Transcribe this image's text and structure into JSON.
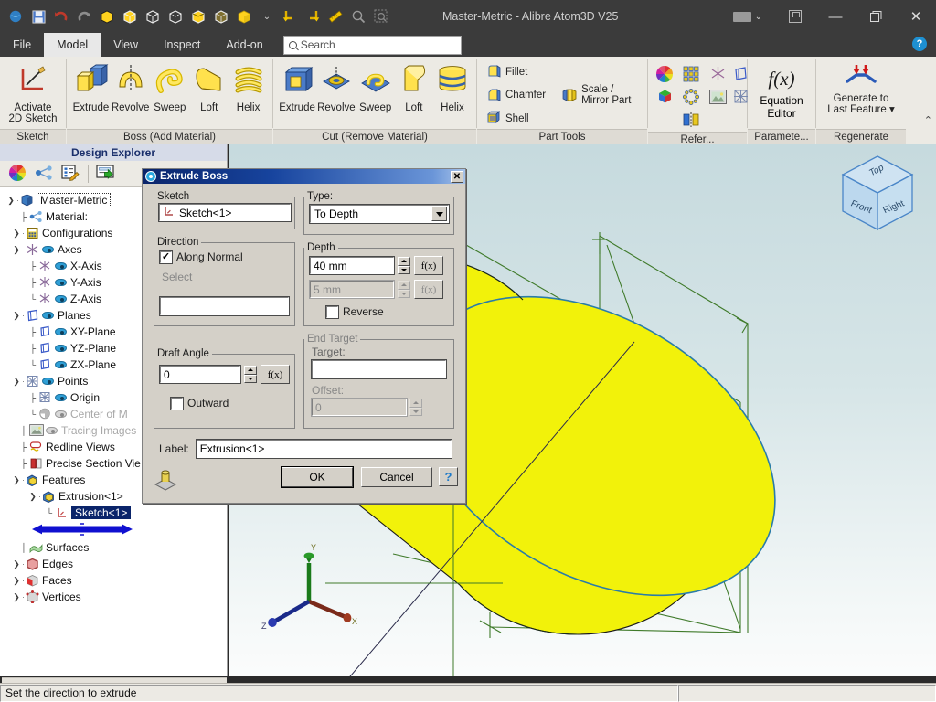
{
  "window": {
    "title": "Master-Metric - Alibre Atom3D V25",
    "minimize_label": "—",
    "maximize_label": "❐",
    "close_label": "✕",
    "ribbon_display_label": "ribbon-display-options",
    "help_label": "?"
  },
  "quick_access": {
    "items": [
      {
        "name": "home-icon",
        "tip": "Home"
      },
      {
        "name": "save-icon",
        "tip": "Save"
      },
      {
        "name": "undo-icon",
        "tip": "Undo"
      },
      {
        "name": "redo-icon",
        "tip": "Redo"
      },
      {
        "name": "display-shaded-icon",
        "tip": "Shaded"
      },
      {
        "name": "display-shaded-edges-icon",
        "tip": "Shaded with Edges"
      },
      {
        "name": "display-wireframe-icon",
        "tip": "Wireframe"
      },
      {
        "name": "display-hidden-line-icon",
        "tip": "Hidden Line"
      },
      {
        "name": "display-hidden-line-removed-icon",
        "tip": "Hidden Line Removed"
      },
      {
        "name": "display-transparent-icon",
        "tip": "Transparent"
      },
      {
        "name": "display-realistic-icon",
        "tip": "Realistic"
      },
      {
        "name": "display-more-chevron-icon",
        "tip": "More"
      },
      {
        "name": "rotate-left-icon",
        "tip": "Rotate Left"
      },
      {
        "name": "rotate-right-icon",
        "tip": "Rotate Right"
      },
      {
        "name": "measure-icon",
        "tip": "Measure"
      },
      {
        "name": "zoom-icon",
        "tip": "Zoom"
      },
      {
        "name": "zoom-window-icon",
        "tip": "Zoom Window"
      }
    ]
  },
  "tabs": {
    "items": [
      {
        "label": "File",
        "active": false
      },
      {
        "label": "Model",
        "active": true
      },
      {
        "label": "View",
        "active": false
      },
      {
        "label": "Inspect",
        "active": false
      },
      {
        "label": "Add-on",
        "active": false
      }
    ]
  },
  "search": {
    "placeholder": "Search",
    "value": ""
  },
  "ribbon": {
    "groups": [
      {
        "label": "Sketch",
        "buttons": [
          {
            "label": "Activate\n2D Sketch",
            "label_line1": "Activate",
            "label_line2": "2D Sketch",
            "icon": "activate-2d-sketch-icon"
          }
        ]
      },
      {
        "label": "Boss (Add Material)",
        "buttons": [
          {
            "label": "Extrude",
            "icon": "boss-extrude-icon"
          },
          {
            "label": "Revolve",
            "icon": "boss-revolve-icon"
          },
          {
            "label": "Sweep",
            "icon": "boss-sweep-icon"
          },
          {
            "label": "Loft",
            "icon": "boss-loft-icon"
          },
          {
            "label": "Helix",
            "icon": "boss-helix-icon"
          }
        ]
      },
      {
        "label": "Cut (Remove Material)",
        "buttons": [
          {
            "label": "Extrude",
            "icon": "cut-extrude-icon"
          },
          {
            "label": "Revolve",
            "icon": "cut-revolve-icon"
          },
          {
            "label": "Sweep",
            "icon": "cut-sweep-icon"
          },
          {
            "label": "Loft",
            "icon": "cut-loft-icon"
          },
          {
            "label": "Helix",
            "icon": "cut-helix-icon"
          }
        ]
      },
      {
        "label": "Part Tools",
        "items": [
          {
            "label": "Fillet",
            "icon": "fillet-icon"
          },
          {
            "label": "Chamfer",
            "icon": "chamfer-icon"
          },
          {
            "label": "Shell",
            "icon": "shell-icon"
          },
          {
            "label": "Scale / Mirror Part",
            "icon": "scale-mirror-part-icon"
          }
        ]
      },
      {
        "label": "Refer...",
        "icons": [
          {
            "name": "color-wheel-icon"
          },
          {
            "name": "material-cube-icon"
          },
          {
            "name": "pattern-grid-icon"
          },
          {
            "name": "circular-pattern-icon"
          },
          {
            "name": "mirror-icon"
          },
          {
            "name": "reference-axis-icon"
          },
          {
            "name": "reference-plane-icon"
          },
          {
            "name": "tracing-image-icon"
          },
          {
            "name": "reference-point-icon"
          }
        ]
      },
      {
        "label": "Paramete...",
        "buttons": [
          {
            "label_line1": "Equation",
            "label_line2": "Editor",
            "icon": "equation-editor-icon",
            "glyph": "f(x)"
          }
        ]
      },
      {
        "label": "Regenerate",
        "buttons": [
          {
            "label_line1": "Generate to",
            "label_line2": "Last Feature ▾",
            "icon": "generate-to-last-feature-icon"
          }
        ]
      }
    ],
    "collapse_label": "⌃"
  },
  "design_explorer": {
    "title": "Design Explorer",
    "toolbar": [
      {
        "name": "color-properties-icon"
      },
      {
        "name": "relationships-icon"
      },
      {
        "name": "edit-properties-icon"
      },
      {
        "name": "export-notes-icon"
      }
    ],
    "tree": [
      {
        "label": "Master-Metric",
        "depth": 0,
        "chevron": "down",
        "icon": "part-icon",
        "eye": "none",
        "style": "dotted"
      },
      {
        "label": "Material:",
        "depth": 1,
        "chevron": "none",
        "icon": "material-icon",
        "eye": "none",
        "style": "normal"
      },
      {
        "label": "Configurations",
        "depth": 1,
        "chevron": "right",
        "icon": "configurations-icon",
        "eye": "none",
        "style": "normal"
      },
      {
        "label": "Axes",
        "depth": 1,
        "chevron": "down",
        "icon": "axis-icon",
        "eye": "on",
        "style": "normal"
      },
      {
        "label": "X-Axis",
        "depth": 2,
        "chevron": "none",
        "icon": "axis-icon",
        "eye": "on",
        "style": "normal"
      },
      {
        "label": "Y-Axis",
        "depth": 2,
        "chevron": "none",
        "icon": "axis-icon",
        "eye": "on",
        "style": "normal"
      },
      {
        "label": "Z-Axis",
        "depth": 2,
        "chevron": "none",
        "icon": "axis-icon",
        "eye": "on",
        "style": "normal"
      },
      {
        "label": "Planes",
        "depth": 1,
        "chevron": "down",
        "icon": "plane-icon",
        "eye": "on",
        "style": "normal"
      },
      {
        "label": "XY-Plane",
        "depth": 2,
        "chevron": "none",
        "icon": "plane-icon",
        "eye": "on",
        "style": "normal"
      },
      {
        "label": "YZ-Plane",
        "depth": 2,
        "chevron": "none",
        "icon": "plane-icon",
        "eye": "on",
        "style": "normal"
      },
      {
        "label": "ZX-Plane",
        "depth": 2,
        "chevron": "none",
        "icon": "plane-icon",
        "eye": "on",
        "style": "normal"
      },
      {
        "label": "Points",
        "depth": 1,
        "chevron": "down",
        "icon": "point-icon",
        "eye": "on",
        "style": "normal"
      },
      {
        "label": "Origin",
        "depth": 2,
        "chevron": "none",
        "icon": "point-icon",
        "eye": "on",
        "style": "normal"
      },
      {
        "label": "Center of M",
        "depth": 2,
        "chevron": "none",
        "icon": "center-of-mass-icon",
        "eye": "off",
        "style": "dim"
      },
      {
        "label": "Tracing Images",
        "depth": 1,
        "chevron": "none",
        "icon": "tracing-images-icon",
        "eye": "off",
        "style": "dim"
      },
      {
        "label": "Redline Views",
        "depth": 1,
        "chevron": "none",
        "icon": "redline-views-icon",
        "eye": "none",
        "style": "normal"
      },
      {
        "label": "Precise Section Vie",
        "depth": 1,
        "chevron": "none",
        "icon": "precise-section-views-icon",
        "eye": "none",
        "style": "normal"
      },
      {
        "label": "Features",
        "depth": 1,
        "chevron": "down",
        "icon": "features-icon",
        "eye": "none",
        "style": "normal"
      },
      {
        "label": "Extrusion<1>",
        "depth": 2,
        "chevron": "down",
        "icon": "extrusion-icon",
        "eye": "none",
        "style": "normal"
      },
      {
        "label": "Sketch<1>",
        "depth": 3,
        "chevron": "none",
        "icon": "sketch-icon",
        "eye": "none",
        "style": "selected"
      },
      {
        "label": "",
        "depth": 3,
        "chevron": "none",
        "icon": "rollback-bar-icon",
        "eye": "none",
        "style": "rollback"
      },
      {
        "label": "Surfaces",
        "depth": 1,
        "chevron": "none",
        "icon": "surfaces-icon",
        "eye": "none",
        "style": "normal"
      },
      {
        "label": "Edges",
        "depth": 1,
        "chevron": "right",
        "icon": "edges-icon",
        "eye": "none",
        "style": "normal"
      },
      {
        "label": "Faces",
        "depth": 1,
        "chevron": "right",
        "icon": "faces-icon",
        "eye": "none",
        "style": "normal"
      },
      {
        "label": "Vertices",
        "depth": 1,
        "chevron": "right",
        "icon": "vertices-icon",
        "eye": "none",
        "style": "normal"
      }
    ]
  },
  "viewport": {
    "view_cube": {
      "top_face": "Top",
      "front_face": "Front",
      "right_face": "Right"
    },
    "triad": {
      "x": "X",
      "y": "Y",
      "z": "Z"
    },
    "model_color": "#f2f20a",
    "plane_color": "#3a7a28",
    "background_top": "#c6dade",
    "background_bottom": "#fbfcfc"
  },
  "dialog": {
    "title": "Extrude Boss",
    "close_label": "✕",
    "sketch": {
      "legend": "Sketch",
      "value": "Sketch<1>"
    },
    "direction": {
      "legend": "Direction",
      "along_normal_label": "Along Normal",
      "along_normal_checked": true,
      "select_label": "Select",
      "select_value": ""
    },
    "draft_angle": {
      "legend": "Draft Angle",
      "value": "0",
      "fx_label": "f(x)",
      "outward_label": "Outward",
      "outward_checked": false
    },
    "type": {
      "legend": "Type:",
      "value": "To Depth"
    },
    "depth": {
      "legend": "Depth",
      "value": "40 mm",
      "second_value": "5 mm",
      "fx_label": "f(x)",
      "fx_label2": "f(x)",
      "reverse_label": "Reverse",
      "reverse_checked": false
    },
    "end_target": {
      "legend": "End Target",
      "target_label": "Target:",
      "target_value": "",
      "offset_label": "Offset:",
      "offset_value": "0"
    },
    "label_field": {
      "label": "Label:",
      "value": "Extrusion<1>"
    },
    "preview_icon": "extrude-preview-icon",
    "ok_label": "OK",
    "cancel_label": "Cancel",
    "help_label": "?"
  },
  "statusbar": {
    "message": "Set the direction to extrude",
    "right_cell": ""
  }
}
